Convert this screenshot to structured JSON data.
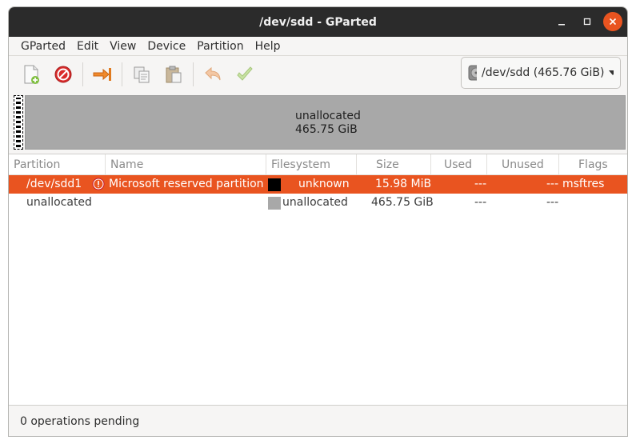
{
  "window": {
    "title": "/dev/sdd - GParted"
  },
  "menubar": {
    "items": [
      "GParted",
      "Edit",
      "View",
      "Device",
      "Partition",
      "Help"
    ]
  },
  "toolbar": {
    "buttons": [
      {
        "icon": "new-partition-icon"
      },
      {
        "icon": "delete-icon"
      },
      {
        "icon": "resize-move-icon"
      },
      {
        "icon": "copy-icon"
      },
      {
        "icon": "paste-icon"
      },
      {
        "icon": "undo-icon"
      },
      {
        "icon": "apply-icon"
      }
    ]
  },
  "device_selector": {
    "label": "/dev/sdd (465.76 GiB)"
  },
  "disk_map": {
    "unallocated_label": "unallocated",
    "unallocated_size": "465.75 GiB"
  },
  "table": {
    "headers": [
      "Partition",
      "Name",
      "Filesystem",
      "Size",
      "Used",
      "Unused",
      "Flags"
    ],
    "rows": [
      {
        "partition": "/dev/sdd1",
        "warning": true,
        "name": "Microsoft reserved partition",
        "fs_color": "#000000",
        "filesystem": "unknown",
        "size": "15.98 MiB",
        "used": "---",
        "unused": "---",
        "flags": "msftres"
      },
      {
        "partition": "unallocated",
        "warning": false,
        "name": "",
        "fs_color": "#a8a8a8",
        "filesystem": "unallocated",
        "size": "465.75 GiB",
        "used": "---",
        "unused": "---",
        "flags": ""
      }
    ]
  },
  "status": {
    "text": "0 operations pending"
  },
  "colors": {
    "accent": "#e95420",
    "titlebar": "#2b2b2b"
  }
}
